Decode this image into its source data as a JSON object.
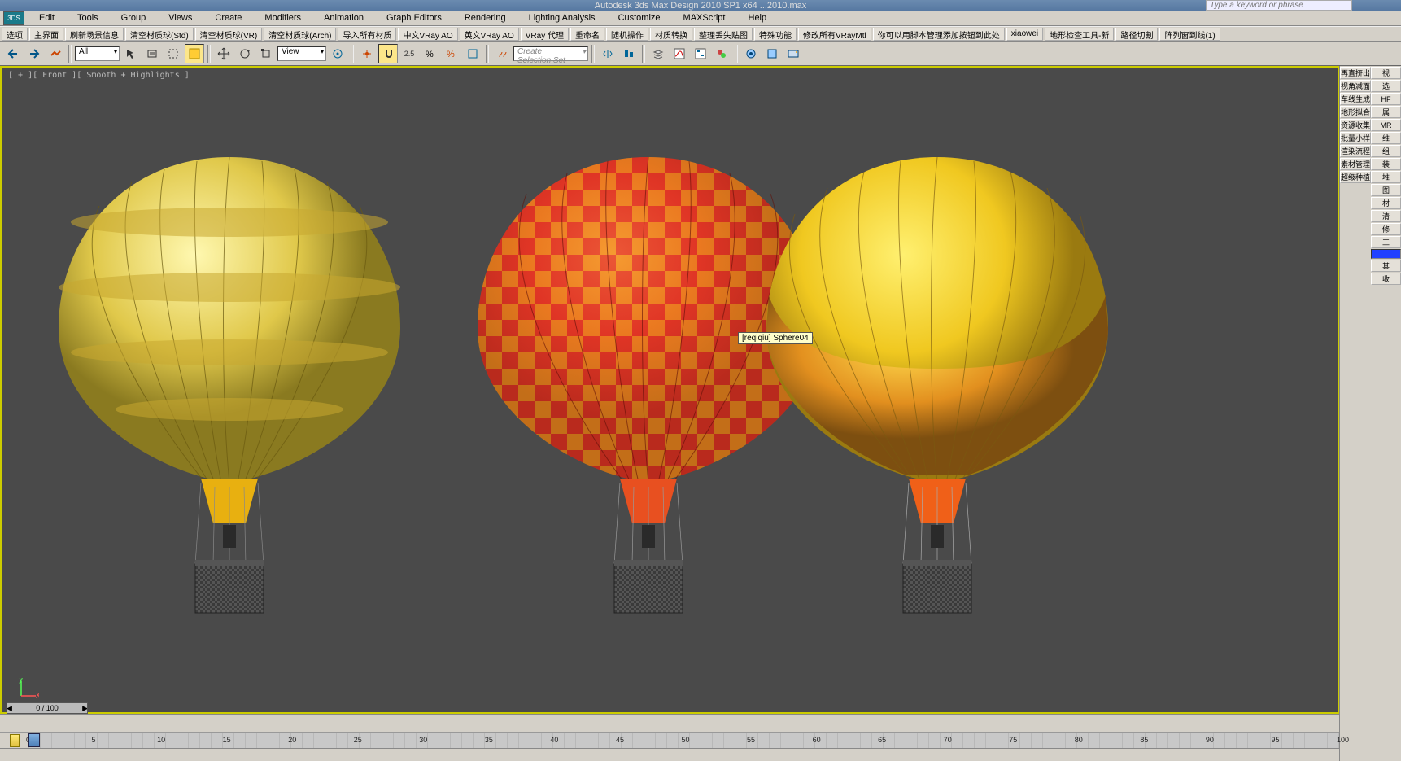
{
  "title": "Autodesk 3ds Max Design 2010 SP1 x64   ...2010.max",
  "search_placeholder": "Type a keyword or phrase",
  "menus": [
    "Edit",
    "Tools",
    "Group",
    "Views",
    "Create",
    "Modifiers",
    "Animation",
    "Graph Editors",
    "Rendering",
    "Lighting Analysis",
    "Customize",
    "MAXScript",
    "Help"
  ],
  "script_buttons": [
    "选项",
    "主界面",
    "刷新场景信息",
    "清空材质球(Std)",
    "清空材质球(VR)",
    "清空材质球(Arch)",
    "导入所有材质",
    "中文VRay AO",
    "英文VRay AO",
    "VRay 代理",
    "重命名",
    "随机操作",
    "材质转换",
    "整理丢失贴图",
    "特殊功能",
    "修改所有VRayMtl",
    "你可以用脚本管理添加按钮到此处",
    "xiaowei",
    "地形检查工具-新",
    "路径切割",
    "阵列窗到线(1)"
  ],
  "selection_filter": "All",
  "view_mode": "View",
  "create_set": "Create Selection Set",
  "viewport_label": "[ + ][ Front ][ Smooth + Highlights ]",
  "tooltip": "[reqiqiu] Sphere04",
  "right_left": [
    "再直挤出",
    "视角减面",
    "车线生成",
    "地形拟合",
    "资源收集",
    "批量小样",
    "渲染流程",
    "素材管理",
    "超级种植"
  ],
  "right_right": [
    "视",
    "选",
    "HF",
    "属",
    "MR",
    "维",
    "组",
    "装",
    "堆",
    "图",
    "材",
    "清",
    "修",
    "工",
    "",
    "其",
    "收"
  ],
  "frame": "0 / 100",
  "tick_labels": [
    "0",
    "5",
    "10",
    "15",
    "20",
    "25",
    "30",
    "35",
    "40",
    "45",
    "50",
    "55",
    "60",
    "65",
    "70",
    "75",
    "80",
    "85",
    "90",
    "95",
    "100"
  ],
  "zoom_val": "2.5"
}
